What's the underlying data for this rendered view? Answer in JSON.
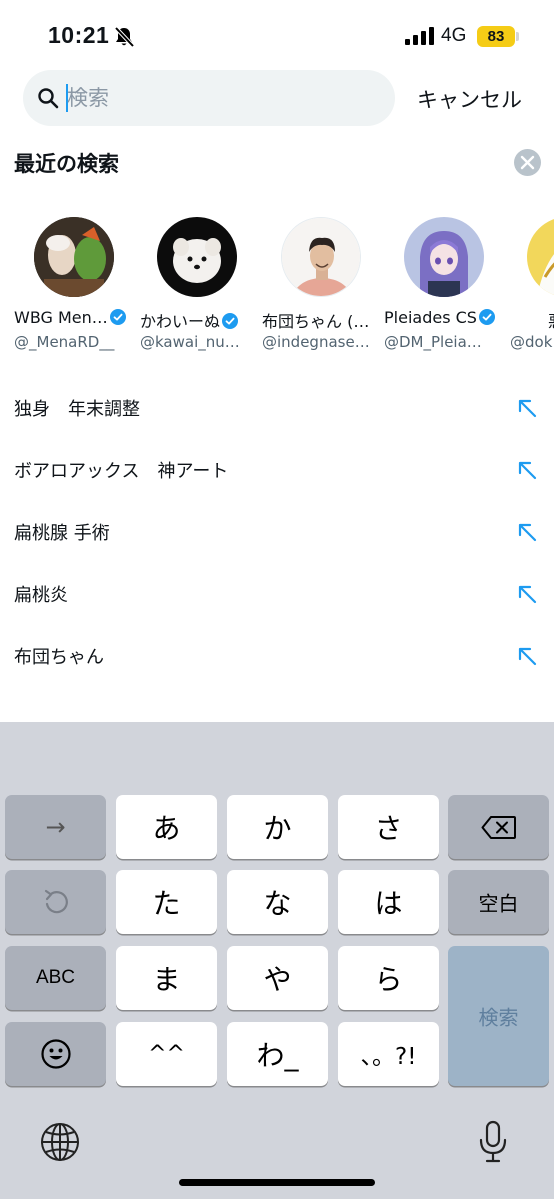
{
  "status_bar": {
    "time": "10:21",
    "network": "4G",
    "battery": "83"
  },
  "search": {
    "placeholder": "検索",
    "value": "",
    "cancel_label": "キャンセル"
  },
  "recent": {
    "title": "最近の検索",
    "accounts": [
      {
        "name": "WBG Men…",
        "handle": "@_MenaRD__",
        "verified": true
      },
      {
        "name": "かわいーぬ",
        "handle": "@kawai_nu…",
        "verified": true
      },
      {
        "name": "布団ちゃん (…",
        "handle": "@indegnase…",
        "verified": false
      },
      {
        "name": "Pleiades CS",
        "handle": "@DM_Pleia…",
        "verified": true
      },
      {
        "name": "悪",
        "handle": "@dok",
        "verified": false
      }
    ],
    "queries": [
      "独身　年末調整",
      "ボアロアックス　神アート",
      "扁桃腺 手術",
      "扁桃炎",
      "布団ちゃん"
    ]
  },
  "keyboard": {
    "row1": {
      "left": "→",
      "k1": "あ",
      "k2": "か",
      "k3": "さ",
      "right_icon": "delete-icon"
    },
    "row2": {
      "left_icon": "undo-icon",
      "k1": "た",
      "k2": "な",
      "k3": "は",
      "right": "空白"
    },
    "row3": {
      "left": "ABC",
      "k1": "ま",
      "k2": "や",
      "k3": "ら",
      "right": "検索"
    },
    "row4": {
      "left_icon": "emoji-icon",
      "k1": "^^",
      "k2": "わ_",
      "k3": "、。?!"
    },
    "bottom_left_icon": "globe-icon",
    "bottom_right_icon": "microphone-icon"
  },
  "colors": {
    "accent": "#1d9bf0",
    "keyboard_bg": "#d1d4db",
    "battery": "#f5cc16"
  }
}
